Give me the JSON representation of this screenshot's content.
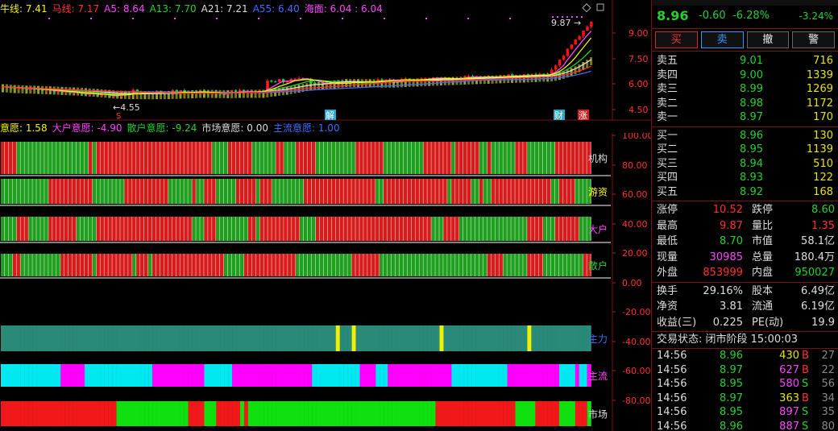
{
  "ma_line": [
    {
      "text": "牛线: 7.41",
      "color": "#f5f500"
    },
    {
      "text": "马线: 7.17",
      "color": "#ff3030"
    },
    {
      "text": "A5: 8.64",
      "color": "#ff44ff"
    },
    {
      "text": "A13: 7.70",
      "color": "#23d12d"
    },
    {
      "text": "A21: 7.21",
      "color": "#dddddd"
    },
    {
      "text": "A55: 6.40",
      "color": "#3f6cff"
    },
    {
      "text": "海面: 6.04 : 6.04",
      "color": "#ff44ff"
    }
  ],
  "main_chart": {
    "axis_labels": [
      "9.00",
      "7.50",
      "6.00",
      "4.50"
    ],
    "high_label": "9.87",
    "low_label": "4.55",
    "event_markers": [
      "解",
      "财",
      "涨"
    ],
    "s_marker": "S"
  },
  "indicator_line": [
    {
      "text": "意愿: 1.58",
      "color": "#f5f500"
    },
    {
      "text": "大户意愿: -4.90",
      "color": "#ff44ff"
    },
    {
      "text": "散户意愿: -9.24",
      "color": "#23d12d"
    },
    {
      "text": "市场意愿: 0.00",
      "color": "#dddddd"
    },
    {
      "text": "主流意愿: 1.00",
      "color": "#3f6cff"
    }
  ],
  "sub_chart": {
    "axis_labels": [
      "100.00",
      "80.00",
      "60.00",
      "40.00",
      "20.00",
      "0.00",
      "-20.00",
      "-40.00",
      "-60.00",
      "-80.00"
    ],
    "band_labels": [
      "机构",
      "游资",
      "大户",
      "散户",
      "主力",
      "主流",
      "市场"
    ],
    "band_label_colors": [
      "#dddddd",
      "#f5f500",
      "#ff44ff",
      "#23d12d",
      "#3f6cff",
      "#ff44ff",
      "#dddddd"
    ]
  },
  "quote": {
    "price": "8.96",
    "change": "-0.60",
    "change_pct": "-6.28%",
    "corner_pct": "-3.24%",
    "buttons": [
      "买",
      "卖",
      "撤",
      "警"
    ]
  },
  "asks": [
    {
      "label": "卖五",
      "price": "9.01",
      "vol": "716"
    },
    {
      "label": "卖四",
      "price": "9.00",
      "vol": "1339"
    },
    {
      "label": "卖三",
      "price": "8.99",
      "vol": "1269"
    },
    {
      "label": "卖二",
      "price": "8.98",
      "vol": "1172"
    },
    {
      "label": "卖一",
      "price": "8.97",
      "vol": "170"
    }
  ],
  "bids": [
    {
      "label": "买一",
      "price": "8.96",
      "vol": "130"
    },
    {
      "label": "买二",
      "price": "8.95",
      "vol": "1139"
    },
    {
      "label": "买三",
      "price": "8.94",
      "vol": "510"
    },
    {
      "label": "买四",
      "price": "8.93",
      "vol": "122"
    },
    {
      "label": "买五",
      "price": "8.92",
      "vol": "168"
    }
  ],
  "stats": [
    {
      "l1": "涨停",
      "v1": "10.52",
      "c1": "#ff3030",
      "l2": "跌停",
      "v2": "8.60",
      "c2": "#23d12d"
    },
    {
      "l1": "最高",
      "v1": "9.87",
      "c1": "#ff3030",
      "l2": "量比",
      "v2": "1.35",
      "c2": "#ff3030"
    },
    {
      "l1": "最低",
      "v1": "8.70",
      "c1": "#23d12d",
      "l2": "市值",
      "v2": "58.1亿",
      "c2": "#dddddd"
    },
    {
      "l1": "现量",
      "v1": "30985",
      "c1": "#ff44ff",
      "l2": "总量",
      "v2": "180.4万",
      "c2": "#dddddd"
    },
    {
      "l1": "外盘",
      "v1": "853999",
      "c1": "#ff3030",
      "l2": "内盘",
      "v2": "950027",
      "c2": "#23d12d"
    }
  ],
  "stats2": [
    {
      "l1": "换手",
      "v1": "29.16%",
      "l2": "股本",
      "v2": "6.49亿"
    },
    {
      "l1": "净资",
      "v1": "3.81",
      "l2": "流通",
      "v2": "6.19亿"
    },
    {
      "l1": "收益(三)",
      "v1": "0.225",
      "l2": "PE(动)",
      "v2": "19.9"
    }
  ],
  "trade_status": "交易状态: 闭市阶段 15:00:03",
  "ticks": [
    {
      "time": "14:56",
      "price": "8.96",
      "pc": "#23d12d",
      "vol": "430",
      "vc": "#e5e500",
      "side": "B",
      "sc": "#ff3030",
      "n": "27"
    },
    {
      "time": "14:56",
      "price": "8.97",
      "pc": "#23d12d",
      "vol": "627",
      "vc": "#ff44ff",
      "side": "B",
      "sc": "#ff3030",
      "n": "22"
    },
    {
      "time": "14:56",
      "price": "8.95",
      "pc": "#23d12d",
      "vol": "580",
      "vc": "#ff44ff",
      "side": "S",
      "sc": "#23d12d",
      "n": "56"
    },
    {
      "time": "14:56",
      "price": "8.97",
      "pc": "#23d12d",
      "vol": "363",
      "vc": "#e5e500",
      "side": "B",
      "sc": "#ff3030",
      "n": "34"
    },
    {
      "time": "14:56",
      "price": "8.95",
      "pc": "#23d12d",
      "vol": "897",
      "vc": "#ff44ff",
      "side": "S",
      "sc": "#23d12d",
      "n": "35"
    },
    {
      "time": "14:56",
      "price": "8.96",
      "pc": "#23d12d",
      "vol": "887",
      "vc": "#ff44ff",
      "side": "S",
      "sc": "#23d12d",
      "n": "80"
    }
  ]
}
